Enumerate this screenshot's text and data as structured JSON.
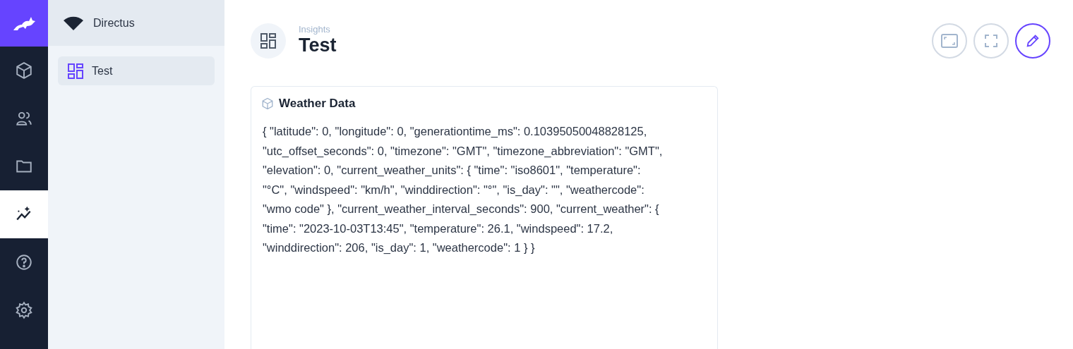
{
  "nav_rail": {
    "items": [
      {
        "kind": "content",
        "selected": false
      },
      {
        "kind": "users",
        "selected": false
      },
      {
        "kind": "files",
        "selected": false
      },
      {
        "kind": "insights",
        "selected": true
      },
      {
        "kind": "help",
        "selected": false
      },
      {
        "kind": "settings",
        "selected": false
      }
    ]
  },
  "sidebar": {
    "project": "Directus",
    "items": [
      {
        "label": "Test",
        "selected": true
      }
    ]
  },
  "header": {
    "breadcrumb": "Insights",
    "title": "Test"
  },
  "panel": {
    "title": "Weather Data",
    "lines": [
      "{ \"latitude\": 0, \"longitude\": 0, \"generationtime_ms\": 0.10395050048828125,",
      "\"utc_offset_seconds\": 0, \"timezone\": \"GMT\", \"timezone_abbreviation\": \"GMT\",",
      "\"elevation\": 0, \"current_weather_units\": { \"time\": \"iso8601\", \"temperature\":",
      "\"°C\", \"windspeed\": \"km/h\", \"winddirection\": \"°\", \"is_day\": \"\", \"weathercode\":",
      "\"wmo code\" }, \"current_weather_interval_seconds\": 900, \"current_weather\": {",
      "\"time\": \"2023-10-03T13:45\", \"temperature\": 26.1, \"windspeed\": 17.2,",
      "\"winddirection\": 206, \"is_day\": 1, \"weathercode\": 1 } }"
    ]
  }
}
